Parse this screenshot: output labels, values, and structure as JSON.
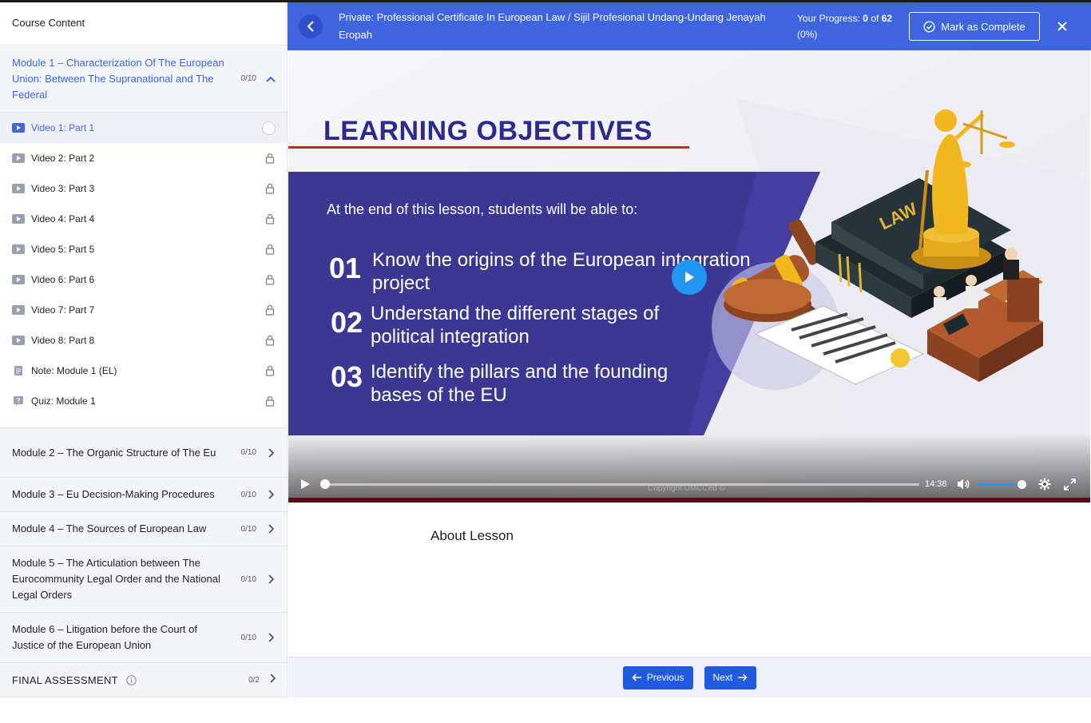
{
  "sidebar": {
    "title": "Course Content",
    "modules": [
      {
        "title": "Module 1 – Characterization Of The European Union: Between The Supranational and The Federal",
        "count": "0/10",
        "expanded": true
      },
      {
        "title": "Module 2 – The Organic Structure of The Eu",
        "count": "0/10"
      },
      {
        "title": "Module 3 – Eu Decision-Making Procedures",
        "count": "0/10"
      },
      {
        "title": "Module 4 – The Sources of European Law",
        "count": "0/10"
      },
      {
        "title": "Module 5 – The Articulation between The Eurocommunity Legal Order and the National Legal Orders",
        "count": "0/10"
      },
      {
        "title": "Module 6 – Litigation before the Court of Justice of the European Union",
        "count": "0/10"
      }
    ],
    "module1_items": [
      {
        "label": "Video 1: Part 1",
        "icon": "video-icon",
        "state": "current"
      },
      {
        "label": "Video 2: Part 2",
        "icon": "video-icon",
        "state": "locked"
      },
      {
        "label": "Video 3: Part 3",
        "icon": "video-icon",
        "state": "locked"
      },
      {
        "label": "Video 4: Part 4",
        "icon": "video-icon",
        "state": "locked"
      },
      {
        "label": "Video 5: Part 5",
        "icon": "video-icon",
        "state": "locked"
      },
      {
        "label": "Video 6: Part 6",
        "icon": "video-icon",
        "state": "locked"
      },
      {
        "label": "Video 7: Part 7",
        "icon": "video-icon",
        "state": "locked"
      },
      {
        "label": "Video 8: Part 8",
        "icon": "video-icon",
        "state": "locked"
      },
      {
        "label": "Note: Module 1 (EL)",
        "icon": "document-icon",
        "state": "locked"
      },
      {
        "label": "Quiz: Module 1",
        "icon": "quiz-icon",
        "state": "locked"
      }
    ],
    "final_assessment": {
      "title": "FINAL ASSESSMENT",
      "count": "0/2"
    }
  },
  "header": {
    "course_title": "Private: Professional Certificate In European Law / Sijil Profesional Undang-Undang Jenayah Eropah",
    "progress_label": "Your Progress:",
    "progress_done": "0",
    "progress_of": "of",
    "progress_total": "62",
    "progress_pct": "(0%)",
    "mark_complete": "Mark as Complete"
  },
  "video": {
    "slide_title": "LEARNING OBJECTIVES",
    "intro": "At the end of this lesson, students will be able to:",
    "objectives": [
      {
        "num": "01",
        "text": "Know the origins of the European integration project"
      },
      {
        "num": "02",
        "text": "Understand the different stages of political integration"
      },
      {
        "num": "03",
        "text": "Identify the pillars and the founding bases of the EU"
      }
    ],
    "time": "14:38",
    "copyright": "Copyright UMCCed ©",
    "progress_fraction": 0,
    "volume_fraction": 1
  },
  "content": {
    "about": "About Lesson"
  },
  "footer": {
    "previous": "Previous",
    "next": "Next"
  },
  "colors": {
    "accent": "#3e64de",
    "button": "#1f5ae0",
    "slide_panel": "#3d3794",
    "title_red": "#d21f2a"
  }
}
